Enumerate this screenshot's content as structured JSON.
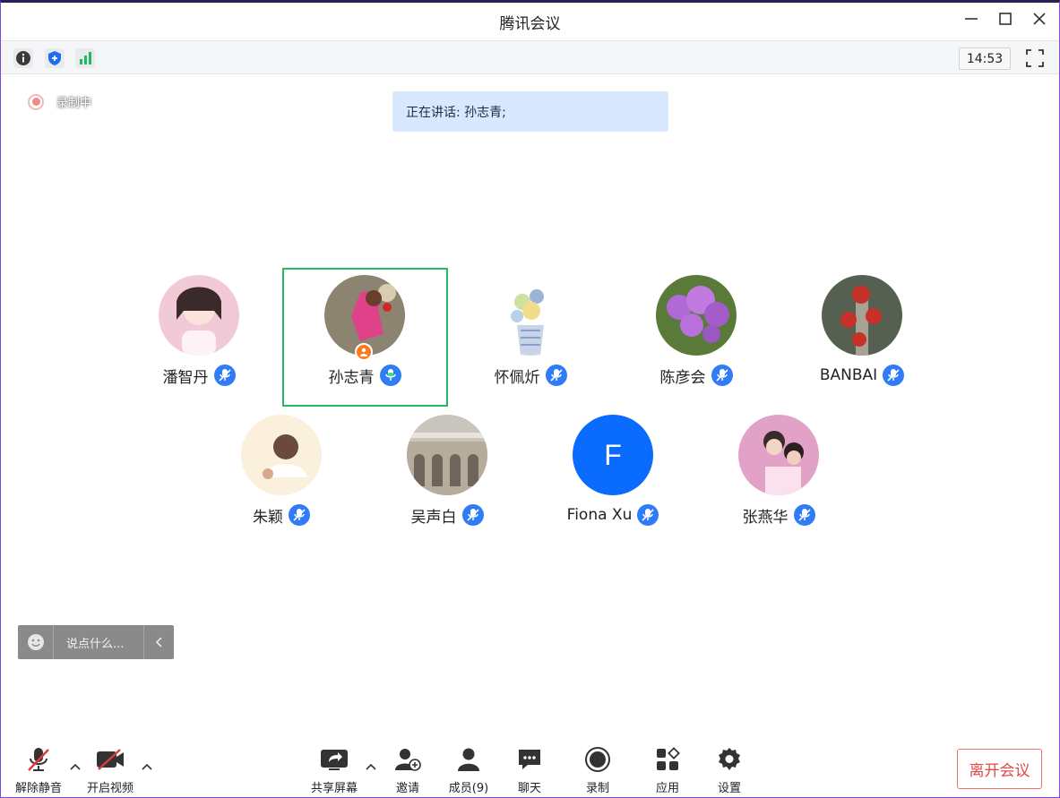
{
  "window": {
    "title": "腾讯会议"
  },
  "toolbar": {
    "clock": "14:53"
  },
  "recording": {
    "label": "录制中"
  },
  "speaking": {
    "text": "正在讲话: 孙志青;"
  },
  "participants": [
    {
      "name": "潘智丹",
      "avatar_colors": [
        "#f2c9d6",
        "#8a5a6a"
      ]
    },
    {
      "name": "孙志青",
      "avatar_colors": [
        "#8c8470",
        "#e0428a"
      ]
    },
    {
      "name": "怀佩炘",
      "avatar_colors": [
        "#eef3e0",
        "#9ab4d8"
      ]
    },
    {
      "name": "陈彦会",
      "avatar_colors": [
        "#5a7a3a",
        "#b06ad8"
      ]
    },
    {
      "name": "BANBAI",
      "avatar_colors": [
        "#556050",
        "#c8302a"
      ]
    },
    {
      "name": "朱颖",
      "avatar_colors": [
        "#faf0dc",
        "#d8a88a"
      ]
    },
    {
      "name": "吴声白",
      "avatar_colors": [
        "#c9c5bc",
        "#6f655a"
      ]
    },
    {
      "name": "Fiona Xu",
      "initial": "F",
      "avatar_colors": [
        "#0a6cff",
        "#0a6cff"
      ]
    },
    {
      "name": "张燕华",
      "avatar_colors": [
        "#e2a2c8",
        "#6a3f56"
      ]
    }
  ],
  "chat": {
    "placeholder": "说点什么..."
  },
  "bottom": {
    "unmute": "解除静音",
    "video": "开启视频",
    "share": "共享屏幕",
    "invite": "邀请",
    "members": "成员(9)",
    "chat": "聊天",
    "record": "录制",
    "apps": "应用",
    "settings": "设置",
    "leave": "离开会议"
  },
  "colors": {
    "accent": "#2f7cf6",
    "active_speaker": "#22bb66",
    "leave": "#e04848"
  }
}
